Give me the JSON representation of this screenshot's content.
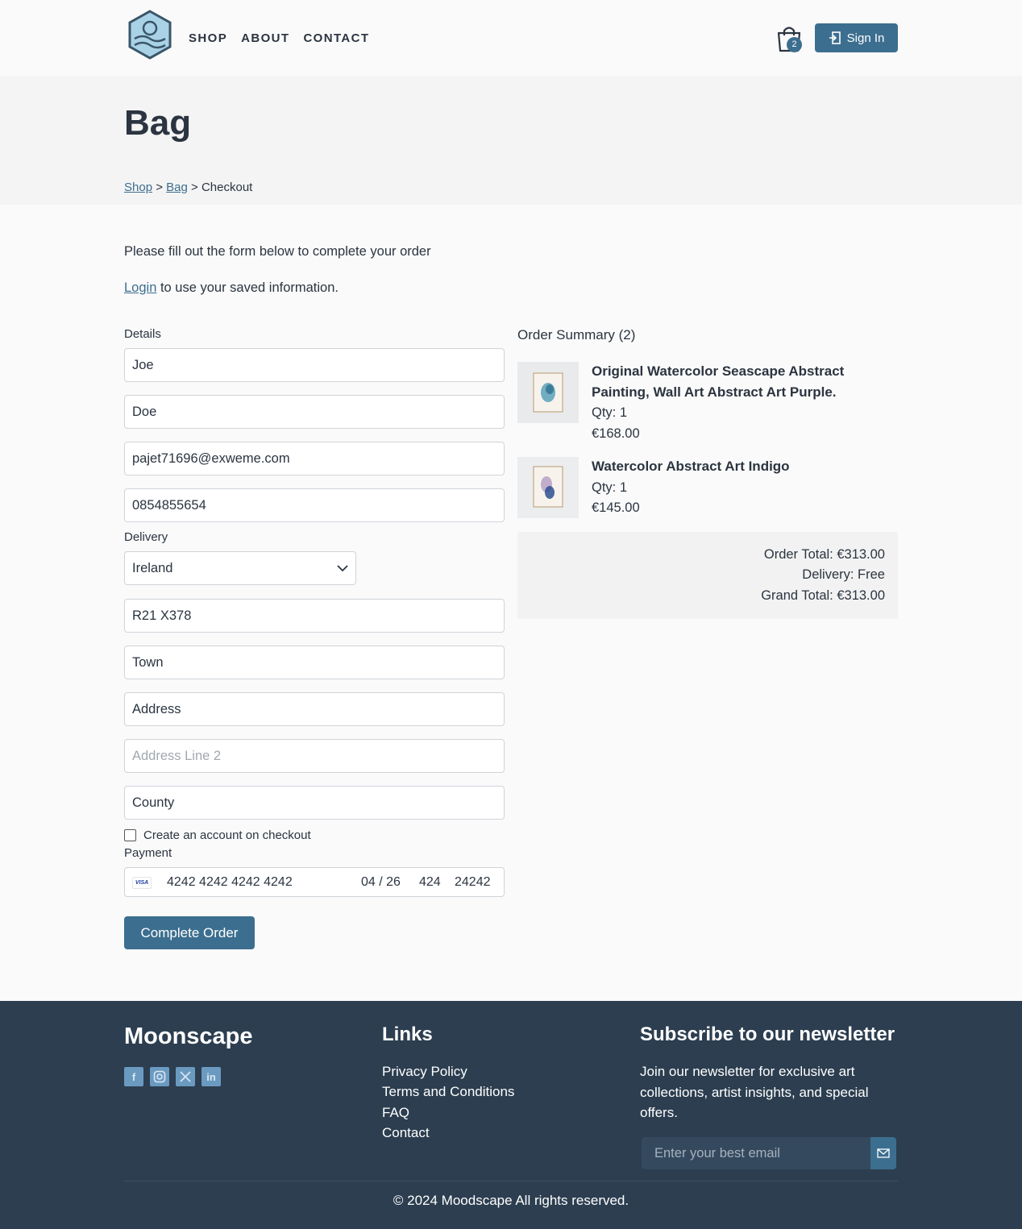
{
  "nav": {
    "items": [
      "SHOP",
      "ABOUT",
      "CONTACT"
    ]
  },
  "header": {
    "bag_count": "2",
    "signin_label": "Sign In"
  },
  "page": {
    "title": "Bag"
  },
  "breadcrumb": {
    "shop": "Shop",
    "sep1": " > ",
    "bag": "Bag",
    "sep2": " > ",
    "current": "Checkout"
  },
  "intro": {
    "line1": "Please fill out the form below to complete your order",
    "login_link": "Login",
    "login_rest": " to use your saved information."
  },
  "form": {
    "details_label": "Details",
    "first_name": "Joe",
    "last_name": "Doe",
    "email": "pajet71696@exweme.com",
    "phone": "0854855654",
    "delivery_label": "Delivery",
    "country": "Ireland",
    "postcode": "R21 X378",
    "town": "Town",
    "address": "Address",
    "address2_placeholder": "Address Line 2",
    "county": "County",
    "create_account_label": "Create an account on checkout",
    "payment_label": "Payment",
    "card_brand": "VISA",
    "card_number": "4242 4242 4242 4242",
    "card_expiry": "04 / 26",
    "card_cvc": "424",
    "card_zip": "24242",
    "submit_label": "Complete Order"
  },
  "summary": {
    "title": "Order Summary (2)",
    "items": [
      {
        "title": "Original Watercolor Seascape Abstract Painting, Wall Art Abstract Art Purple.",
        "qty": "Qty: 1",
        "price": "€168.00"
      },
      {
        "title": "Watercolor Abstract Art Indigo",
        "qty": "Qty: 1",
        "price": "€145.00"
      }
    ],
    "order_total": "Order Total: €313.00",
    "delivery": "Delivery: Free",
    "grand_total": "Grand Total: €313.00"
  },
  "footer": {
    "brand": "Moonscape",
    "socials": [
      "facebook-icon",
      "instagram-icon",
      "x-icon",
      "linkedin-icon"
    ],
    "links_title": "Links",
    "links": [
      "Privacy Policy",
      "Terms and Conditions",
      "FAQ",
      "Contact"
    ],
    "newsletter_title": "Subscribe to our newsletter",
    "newsletter_text": "Join our newsletter for exclusive art collections, artist insights, and special offers.",
    "email_placeholder": "Enter your best email",
    "copyright": "© 2024 Moodscape All rights reserved."
  },
  "colors": {
    "accent": "#3c6e8f",
    "footer_bg": "#2c3e50",
    "text": "#2b3440"
  }
}
